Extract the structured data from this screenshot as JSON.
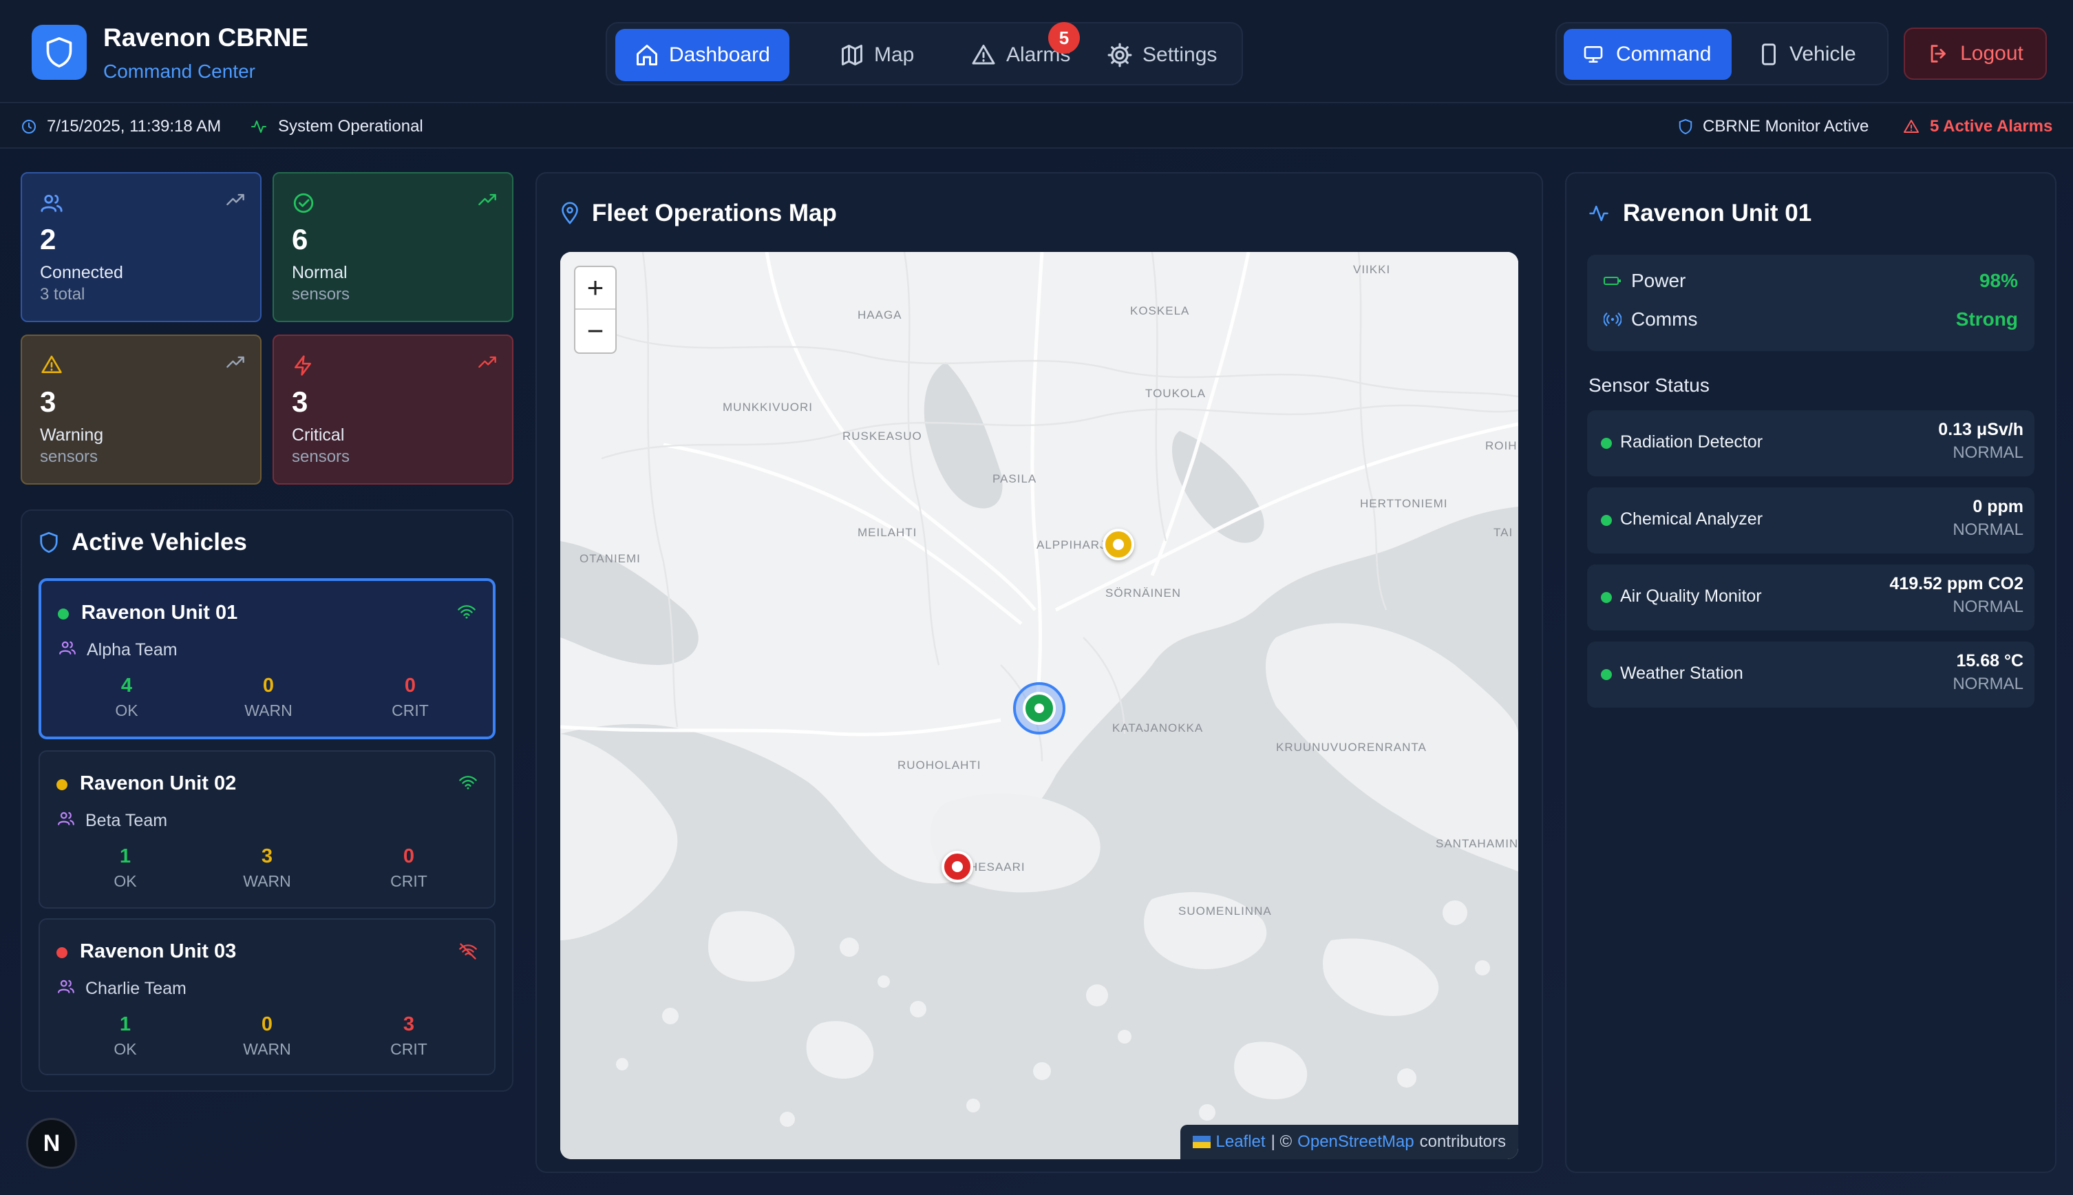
{
  "brand": {
    "title": "Ravenon CBRNE",
    "subtitle": "Command Center"
  },
  "nav": {
    "dashboard": "Dashboard",
    "map": "Map",
    "alarms": "Alarms",
    "alarms_badge": "5",
    "settings": "Settings"
  },
  "modes": {
    "command": "Command",
    "vehicle": "Vehicle"
  },
  "logout": "Logout",
  "status": {
    "datetime": "7/15/2025, 11:39:18 AM",
    "system": "System Operational",
    "monitor": "CBRNE Monitor Active",
    "alarms": "5 Active Alarms"
  },
  "stats": [
    {
      "value": "2",
      "label": "Connected",
      "sub": "3 total",
      "color": "#3b82f6"
    },
    {
      "value": "6",
      "label": "Normal",
      "sub": "sensors",
      "color": "#22c55e"
    },
    {
      "value": "3",
      "label": "Warning",
      "sub": "sensors",
      "color": "#eab308"
    },
    {
      "value": "3",
      "label": "Critical",
      "sub": "sensors",
      "color": "#ef4444"
    }
  ],
  "vehicles": {
    "title": "Active Vehicles",
    "items": [
      {
        "name": "Ravenon Unit 01",
        "team": "Alpha Team",
        "ok": "4",
        "warn": "0",
        "crit": "0",
        "status_color": "#22c55e"
      },
      {
        "name": "Ravenon Unit 02",
        "team": "Beta Team",
        "ok": "1",
        "warn": "3",
        "crit": "0",
        "status_color": "#eab308"
      },
      {
        "name": "Ravenon Unit 03",
        "team": "Charlie Team",
        "ok": "1",
        "warn": "0",
        "crit": "3",
        "status_color": "#ef4444"
      }
    ],
    "ok_label": "OK",
    "warn_label": "WARN",
    "crit_label": "CRIT"
  },
  "map": {
    "title": "Fleet Operations Map",
    "zoom_in": "+",
    "zoom_out": "−",
    "attribution_leaflet": "Leaflet",
    "attribution_sep": "| ©",
    "attribution_osm": "OpenStreetMap",
    "attribution_tail": "contributors",
    "place_labels": [
      "VIIKKI",
      "HAAGA",
      "KOSKELA",
      "MUNKKIVUORI",
      "RUSKEASUO",
      "TOUKOLA",
      "PASILA",
      "ROIH",
      "MEILAHTI",
      "HERTTONIEMI",
      "ALPPIHARJ",
      "TAI",
      "OTANIEMI",
      "SÖRNÄINEN",
      "KATAJANOKKA",
      "KRUUNUVUORENRANTA",
      "RUOHOLAHTI",
      "SANTAHAMIN",
      "HESAARI",
      "SUOMENLINNA"
    ]
  },
  "unit": {
    "title": "Ravenon Unit 01",
    "power_label": "Power",
    "power_value": "98%",
    "comms_label": "Comms",
    "comms_value": "Strong",
    "sensor_heading": "Sensor Status",
    "sensors": [
      {
        "name": "Radiation Detector",
        "reading": "0.13 μSv/h",
        "state": "NORMAL"
      },
      {
        "name": "Chemical Analyzer",
        "reading": "0 ppm",
        "state": "NORMAL"
      },
      {
        "name": "Air Quality Monitor",
        "reading": "419.52 ppm CO2",
        "state": "NORMAL"
      },
      {
        "name": "Weather Station",
        "reading": "15.68 °C",
        "state": "NORMAL"
      }
    ]
  },
  "dev_badge": "N"
}
